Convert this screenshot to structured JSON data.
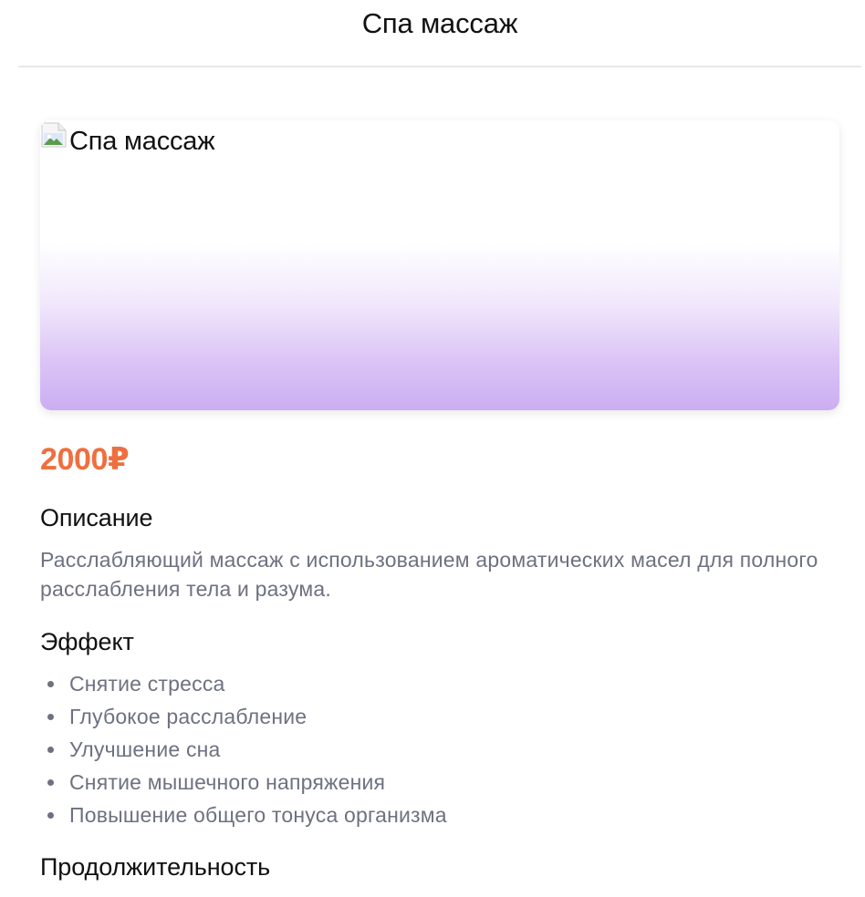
{
  "header": {
    "title": "Спа массаж"
  },
  "hero": {
    "image_alt": "Спа массаж",
    "icon": "broken-image-icon"
  },
  "price": "2000₽",
  "description": {
    "heading": "Описание",
    "text": "Расслабляющий массаж с использованием ароматических масел для полного расслабления тела и разума."
  },
  "effects": {
    "heading": "Эффект",
    "items": [
      "Снятие стресса",
      "Глубокое расслабление",
      "Улучшение сна",
      "Снятие мышечного напряжения",
      "Повышение общего тонуса организма"
    ]
  },
  "duration": {
    "heading": "Продолжительность"
  },
  "colors": {
    "price": "#ee6f3f",
    "muted_text": "#6e7180",
    "hero_gradient_end": "#cbaef2",
    "divider": "#e8e8ea"
  }
}
